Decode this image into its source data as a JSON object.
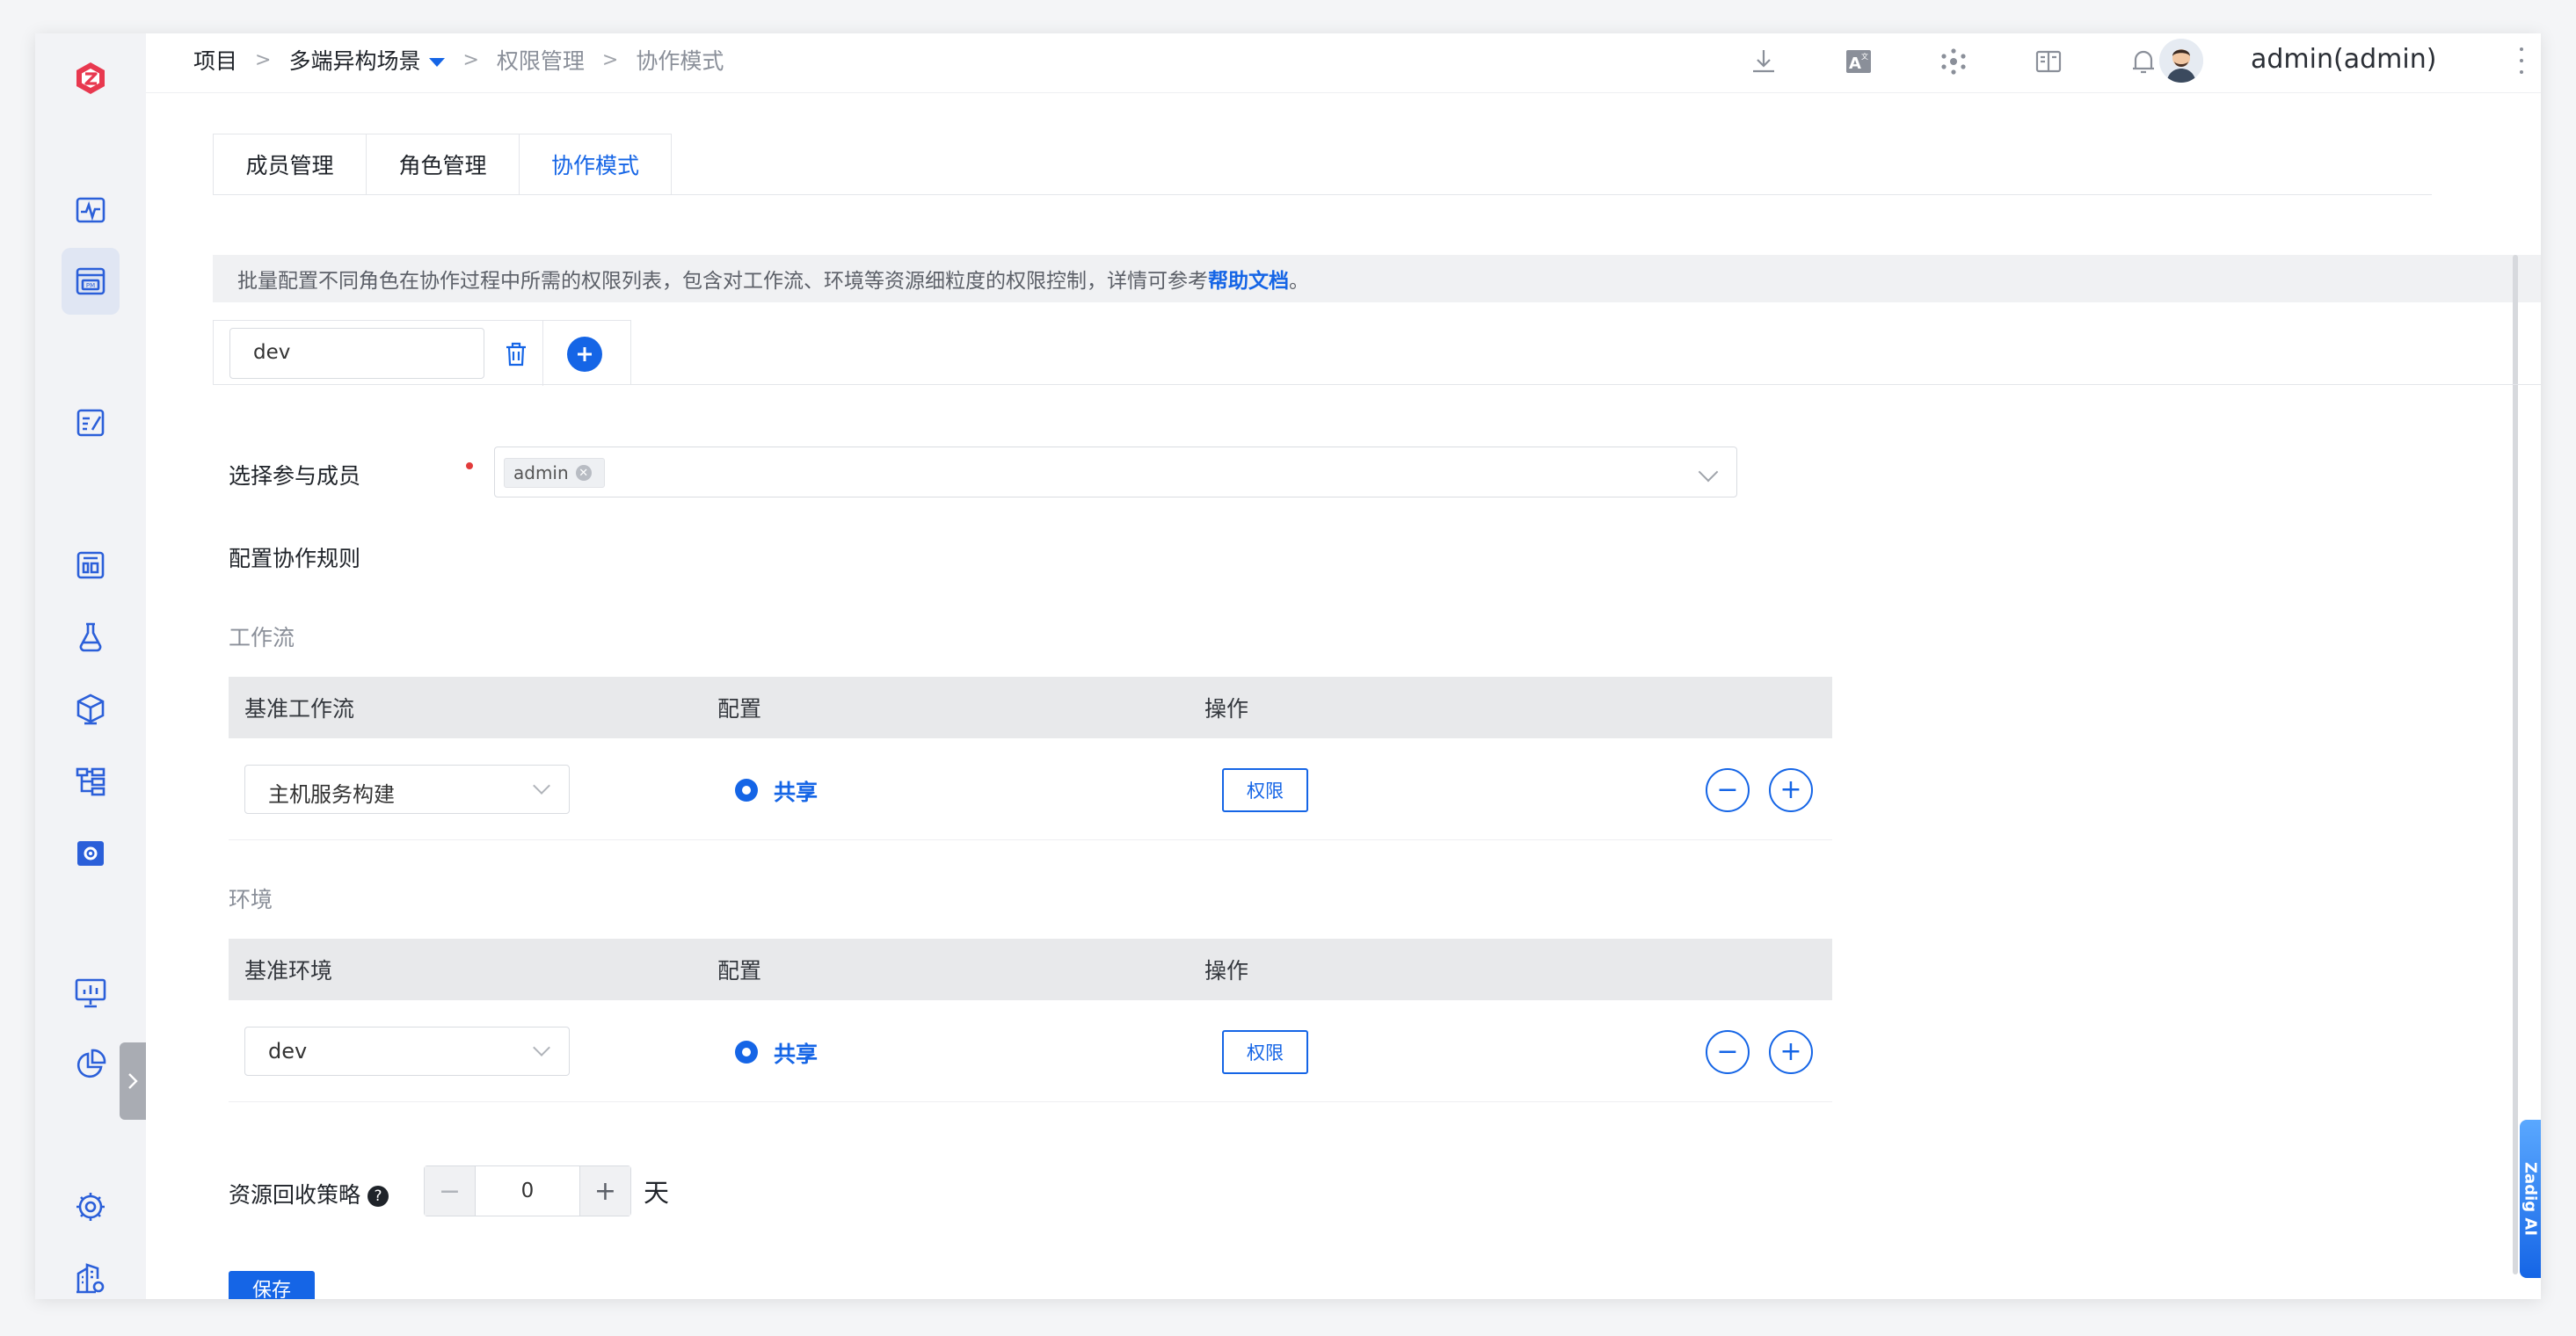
{
  "header": {
    "breadcrumbs": [
      "项目",
      "多端异构场景",
      "权限管理",
      "协作模式"
    ],
    "separator": ">",
    "user_name": "admin(admin)"
  },
  "tabs": [
    {
      "label": "成员管理",
      "active": false
    },
    {
      "label": "角色管理",
      "active": false
    },
    {
      "label": "协作模式",
      "active": true
    }
  ],
  "notice": {
    "text": "批量配置不同角色在协作过程中所需的权限列表，包含对工作流、环境等资源细粒度的权限控制，详情可参考 ",
    "link": "帮助文档",
    "suffix": "。"
  },
  "env_tab": {
    "value": "dev"
  },
  "members": {
    "label": "选择参与成员",
    "tags": [
      "admin"
    ]
  },
  "rules_title": "配置协作规则",
  "workflow": {
    "section_label": "工作流",
    "columns": [
      "基准工作流",
      "配置",
      "操作"
    ],
    "rows": [
      {
        "select": "主机服务构建",
        "config": "共享",
        "action": "权限"
      }
    ]
  },
  "environment": {
    "section_label": "环境",
    "columns": [
      "基准环境",
      "配置",
      "操作"
    ],
    "rows": [
      {
        "select": "dev",
        "config": "共享",
        "action": "权限"
      }
    ]
  },
  "recycle": {
    "label": "资源回收策略",
    "help": "?",
    "value": "0",
    "decrement": "−",
    "increment": "+",
    "unit": "天"
  },
  "save_label": "保存",
  "ai_tab_label": "Zadig AI",
  "colors": {
    "primary": "#1565e6",
    "brand": "#e8384f",
    "required": "#e23b3b"
  },
  "sidebar_icons": [
    "logo-icon",
    "monitor-wave-icon",
    "project-pm-icon",
    "edit-note-icon",
    "dashboard-icon",
    "flask-icon",
    "package-icon",
    "workflow-tree-icon",
    "settings-box-icon",
    "presentation-chart-icon",
    "pie-chart-icon",
    "gear-icon",
    "building-gear-icon"
  ]
}
